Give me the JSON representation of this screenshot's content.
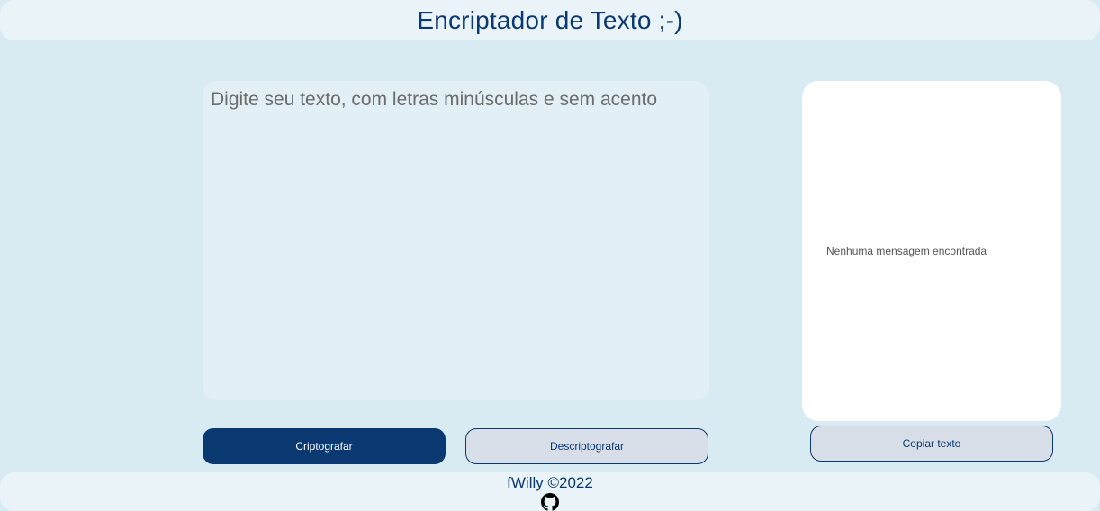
{
  "header": {
    "title": "Encriptador de Texto ;-)"
  },
  "input": {
    "placeholder": "Digite seu texto, com letras minúsculas e sem acento",
    "value": ""
  },
  "buttons": {
    "encrypt_label": "Criptografar",
    "decrypt_label": "Descriptografar",
    "copy_label": "Copiar texto"
  },
  "output": {
    "empty_message": "Nenhuma mensagem encontrada"
  },
  "footer": {
    "credit": "fWilly ©2022",
    "icon": "github-icon"
  },
  "colors": {
    "background": "#d8ebf3",
    "primary": "#0a3871",
    "secondary_button": "#d8dee8",
    "panel": "#ffffff"
  }
}
